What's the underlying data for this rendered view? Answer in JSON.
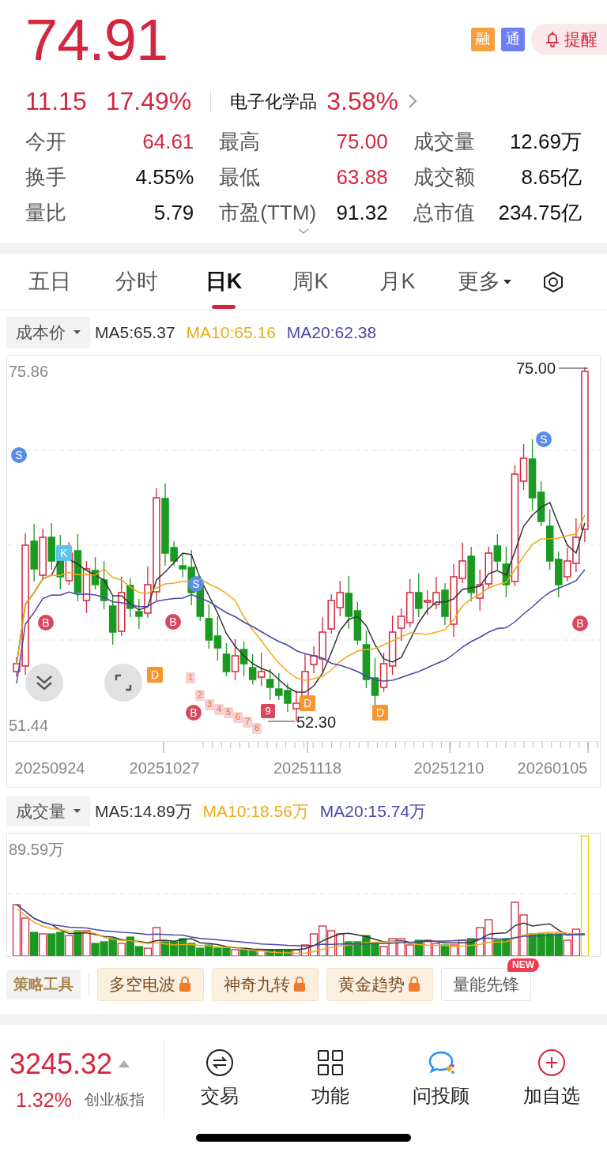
{
  "quote": {
    "price": "74.91",
    "change": "11.15",
    "change_pct": "17.49%",
    "sector": "电子化学品",
    "sector_pct": "3.58%"
  },
  "badges": [
    {
      "label": "融",
      "color": "#f6a03c"
    },
    {
      "label": "通",
      "color": "#6f7ff2"
    }
  ],
  "alert_button": {
    "label": "提醒"
  },
  "stats": [
    {
      "label": "今开",
      "value": "64.61",
      "kind": "up"
    },
    {
      "label": "最高",
      "value": "75.00",
      "kind": "up"
    },
    {
      "label": "成交量",
      "value": "12.69万",
      "kind": "flat"
    },
    {
      "label": "换手",
      "value": "4.55%",
      "kind": "flat"
    },
    {
      "label": "最低",
      "value": "63.88",
      "kind": "up"
    },
    {
      "label": "成交额",
      "value": "8.65亿",
      "kind": "flat"
    },
    {
      "label": "量比",
      "value": "5.79",
      "kind": "flat"
    },
    {
      "label": "市盈(TTM)",
      "value": "91.32",
      "kind": "flat"
    },
    {
      "label": "总市值",
      "value": "234.75亿",
      "kind": "flat"
    }
  ],
  "tabs": [
    {
      "label": "五日",
      "selected": false,
      "kind": "tab"
    },
    {
      "label": "分时",
      "selected": false,
      "kind": "tab"
    },
    {
      "label": "日K",
      "selected": true,
      "kind": "tab"
    },
    {
      "label": "周K",
      "selected": false,
      "kind": "tab"
    },
    {
      "label": "月K",
      "selected": false,
      "kind": "tab"
    },
    {
      "label": "更多",
      "selected": false,
      "kind": "menu"
    }
  ],
  "price_indicators": {
    "selector": "成本价",
    "ma": [
      {
        "label": "MA5:65.37",
        "color": "#333333"
      },
      {
        "label": "MA10:65.16",
        "color": "#f0a91a"
      },
      {
        "label": "MA20:62.38",
        "color": "#4b47a8"
      }
    ]
  },
  "price_chart": {
    "max_label": "75.86",
    "min_label": "51.44",
    "high_label": "75.00",
    "low_label": "52.30",
    "signals": [
      {
        "label": "S",
        "kind": "sell"
      },
      {
        "label": "K",
        "kind": "k"
      },
      {
        "label": "B",
        "kind": "buy"
      },
      {
        "label": "D",
        "kind": "d"
      },
      {
        "label": "B",
        "kind": "buy"
      },
      {
        "label": "S",
        "kind": "sell"
      },
      {
        "label": "1",
        "kind": "count"
      },
      {
        "label": "2",
        "kind": "count"
      },
      {
        "label": "3",
        "kind": "count"
      },
      {
        "label": "4",
        "kind": "count"
      },
      {
        "label": "5",
        "kind": "count"
      },
      {
        "label": "6",
        "kind": "count"
      },
      {
        "label": "7",
        "kind": "count"
      },
      {
        "label": "8",
        "kind": "count"
      },
      {
        "label": "B",
        "kind": "buy"
      },
      {
        "label": "9",
        "kind": "count_final"
      },
      {
        "label": "D",
        "kind": "d"
      },
      {
        "label": "D",
        "kind": "d"
      },
      {
        "label": "S",
        "kind": "sell"
      },
      {
        "label": "B",
        "kind": "buy"
      }
    ]
  },
  "dates": [
    "20250924",
    "20251027",
    "20251118",
    "20251210",
    "20260105"
  ],
  "volume_indicators": {
    "selector": "成交量",
    "ma": [
      {
        "label": "MA5:14.89万",
        "color": "#333333"
      },
      {
        "label": "MA10:18.56万",
        "color": "#f0a91a"
      },
      {
        "label": "MA20:15.74万",
        "color": "#4b47a8"
      }
    ]
  },
  "volume_chart": {
    "max_label": "89.59万"
  },
  "strategy": {
    "title": "策略工具",
    "tools": [
      {
        "label": "多空电波",
        "locked": true
      },
      {
        "label": "神奇九转",
        "locked": true
      },
      {
        "label": "黄金趋势",
        "locked": true
      },
      {
        "label": "量能先锋",
        "locked": false,
        "badge": "NEW"
      }
    ]
  },
  "index_quote": {
    "value": "3245.32",
    "change_pct": "1.32%",
    "name": "创业板指",
    "rising": true
  },
  "actions": [
    {
      "label": "交易",
      "kind": "trade"
    },
    {
      "label": "功能",
      "kind": "grid"
    },
    {
      "label": "问投顾",
      "kind": "chat"
    },
    {
      "label": "加自选",
      "kind": "add"
    }
  ]
}
